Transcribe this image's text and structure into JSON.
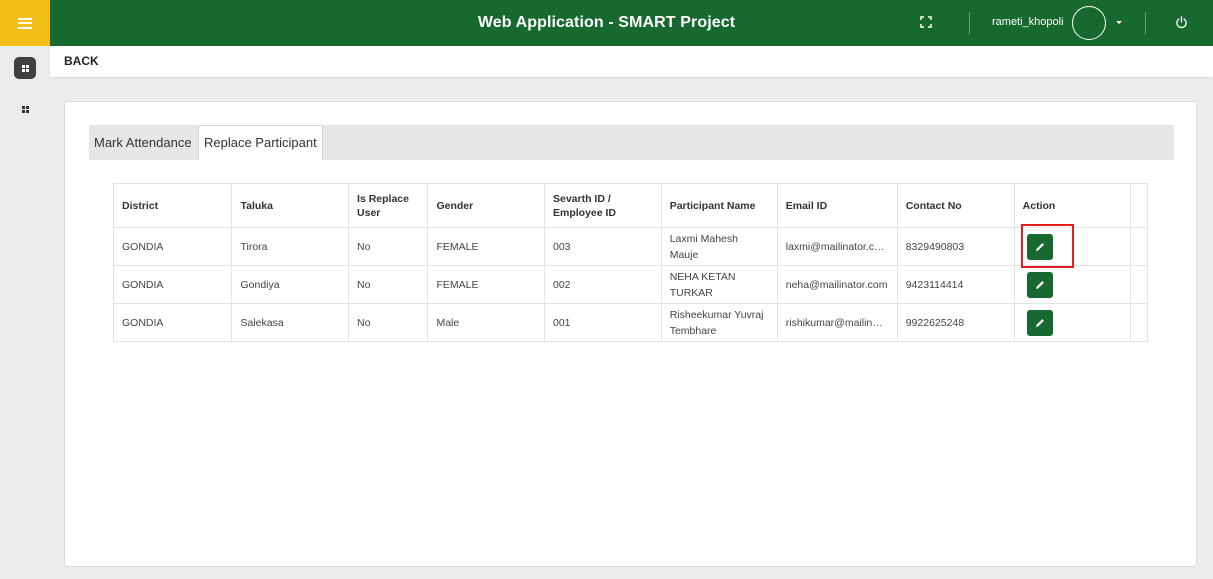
{
  "header": {
    "title": "Web Application - SMART Project",
    "username": "rameti_khopoli",
    "menu_icon": "hamburger-icon",
    "fullscreen_icon": "fullscreen-icon",
    "power_icon": "power-icon",
    "colors": {
      "bar": "#17692f",
      "menu_button": "#f2c019"
    }
  },
  "nav": {
    "back_label": "BACK"
  },
  "tabs": [
    {
      "label": "Mark Attendance",
      "active": false
    },
    {
      "label": "Replace Participant",
      "active": true
    }
  ],
  "table": {
    "columns": [
      "District",
      "Taluka",
      "Is Replace User",
      "Gender",
      "Sevarth ID / Employee ID",
      "Participant Name",
      "Email ID",
      "Contact No",
      "Action"
    ],
    "rows": [
      {
        "district": "GONDIA",
        "taluka": "Tirora",
        "is_replace": "No",
        "gender": "FEMALE",
        "id": "003",
        "name": "Laxmi Mahesh Mauje",
        "email": "laxmi@mailinator.com",
        "contact": "8329490803"
      },
      {
        "district": "GONDIA",
        "taluka": "Gondiya",
        "is_replace": "No",
        "gender": "FEMALE",
        "id": "002",
        "name": "NEHA KETAN TURKAR",
        "email": "neha@mailinator.com",
        "contact": "9423114414"
      },
      {
        "district": "GONDIA",
        "taluka": "Salekasa",
        "is_replace": "No",
        "gender": "Male",
        "id": "001",
        "name": "Risheekumar Yuvraj Tembhare",
        "email": "rishikumar@mailinat...",
        "contact": "9922625248"
      }
    ],
    "action_icon": "pencil-icon",
    "colors": {
      "action_button": "#17692f",
      "highlight_box": "#e1201f"
    }
  }
}
